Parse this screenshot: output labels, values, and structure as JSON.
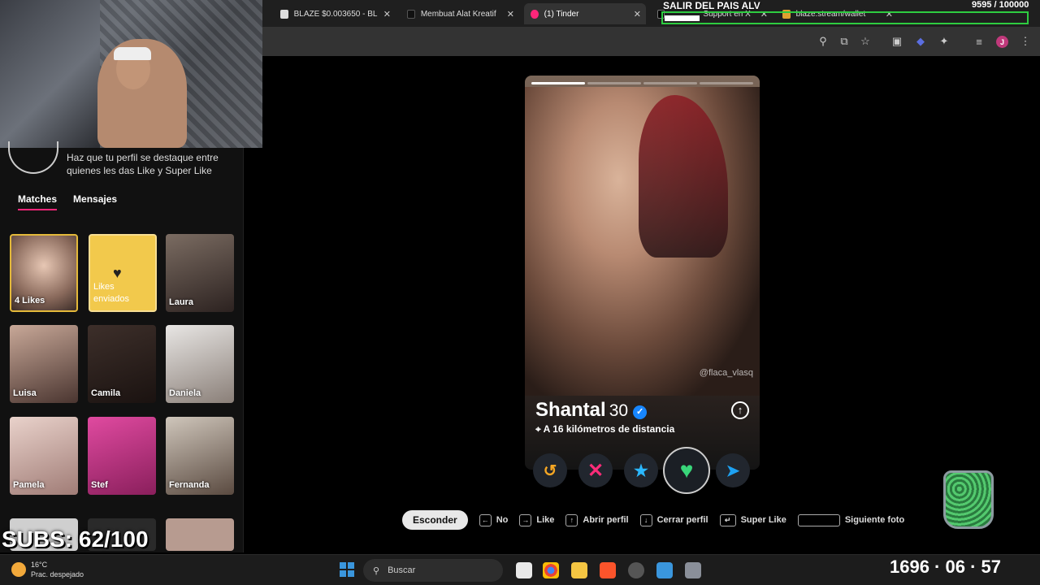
{
  "browser": {
    "tabs": [
      {
        "label": "BLAZE $0.003650 - BL",
        "favicon_color": "#dddddd"
      },
      {
        "label": "Membuat Alat Kreatif",
        "favicon_color": "#111111"
      },
      {
        "label": "(1) Tinder",
        "favicon_color": "#fd267a"
      },
      {
        "label": "Support en X",
        "favicon_color": "#000000"
      },
      {
        "label": "blaze.stream/wallet",
        "favicon_color": "#e0a030"
      }
    ],
    "close_glyph": "✕",
    "toolbar_icons": [
      "location-icon",
      "install-icon",
      "star-icon",
      "picture-icon",
      "extension-icon",
      "puzzle-icon",
      "media-icon"
    ],
    "profile_initial": "J"
  },
  "overlay": {
    "title": "SALIR DEL PAIS ALV",
    "counter": "9595 / 100000",
    "progress_fraction": 0.0959,
    "subs": "SUBS: 62/100"
  },
  "sidebar": {
    "promo_text": "Haz que tu perfil se destaque entre quienes les das Like y Super Like",
    "tabs": {
      "matches": "Matches",
      "messages": "Mensajes"
    },
    "likes_card": {
      "label": "4 Likes"
    },
    "sent_card": {
      "line1": "Likes",
      "line2": "enviados"
    },
    "matches": [
      {
        "name": "Laura"
      },
      {
        "name": "Luisa"
      },
      {
        "name": "Camila"
      },
      {
        "name": "Daniela"
      },
      {
        "name": "Pamela"
      },
      {
        "name": "Stef"
      },
      {
        "name": "Fernanda"
      }
    ]
  },
  "profile": {
    "name": "Shantal",
    "age": "30",
    "distance": "A 16 kilómetros de distancia",
    "watermark": "@flaca_vlasq",
    "photo_count": 4,
    "current_photo": 1
  },
  "actions": {
    "rewind": "↺",
    "nope": "✕",
    "super": "★",
    "like": "♥",
    "boost": "➤"
  },
  "hints": {
    "hide": "Esconder",
    "no": "No",
    "like": "Like",
    "open": "Abrir perfil",
    "close": "Cerrar perfil",
    "superlike": "Super Like",
    "next": "Siguiente foto"
  },
  "taskbar": {
    "temp": "16°C",
    "weather": "Prac. despejado",
    "search": "Buscar",
    "clock": "1696 · 06 · 57"
  },
  "colors": {
    "tinder_pink": "#fd267a",
    "gold": "#f2c94c",
    "verified_blue": "#1786ff",
    "nope_pink": "#ff2c79",
    "super_blue": "#2bb8ff",
    "like_green": "#39d67a",
    "boost_blue": "#1da1f2",
    "rewind_orange": "#f5a623"
  }
}
